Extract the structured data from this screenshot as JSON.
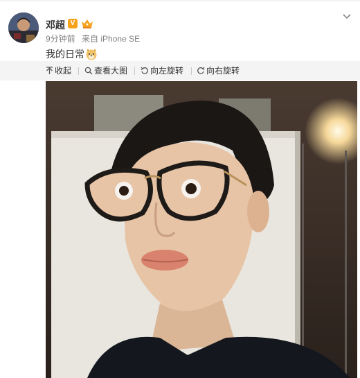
{
  "post": {
    "username": "邓超",
    "verified_badge": "V",
    "time": "9分钟前",
    "source_prefix": "来自",
    "source": "iPhone SE",
    "text": "我的日常"
  },
  "toolbar": {
    "collapse": "收起",
    "view_large": "查看大图",
    "rotate_left": "向左旋转",
    "rotate_right": "向右旋转"
  },
  "icons": {
    "avatar": "user-avatar",
    "verified": "verified-icon",
    "vip": "vip-crown-icon",
    "menu": "chevron-down-icon",
    "emoji": "doge-emoji-icon",
    "collapse": "arrow-up-icon",
    "view_large": "search-icon",
    "rotate_left": "rotate-left-icon",
    "rotate_right": "rotate-right-icon"
  },
  "colors": {
    "badge": "#f7a21b",
    "toolbar_bg": "#f4f4f4",
    "meta_text": "#808080"
  }
}
